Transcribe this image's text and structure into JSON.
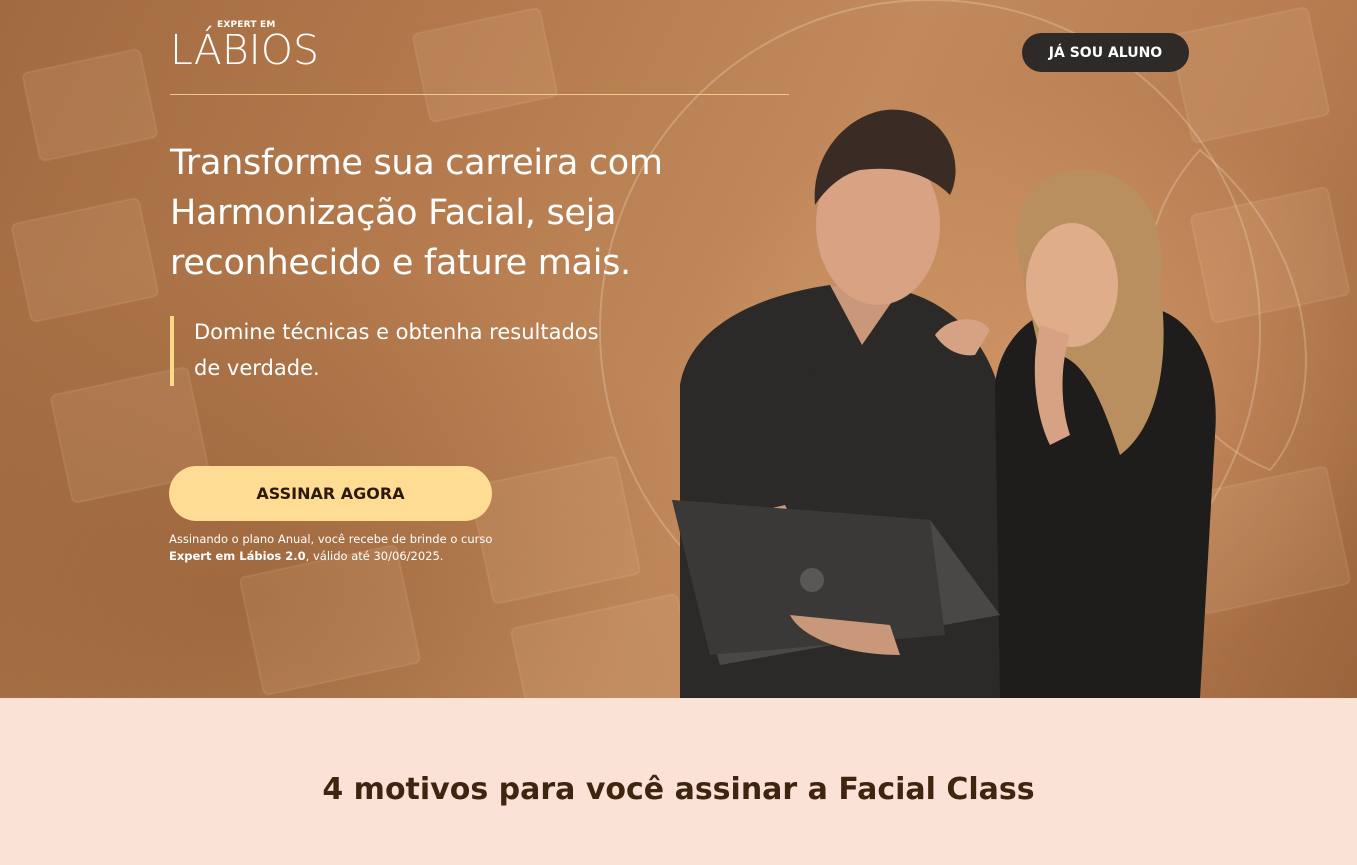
{
  "header": {
    "logo_small": "EXPERT EM",
    "logo_big": "LÁBIOS",
    "student_button": "JÁ SOU ALUNO"
  },
  "hero": {
    "headline": "Transforme sua carreira com Harmonização Facial, seja reconhecido e fature mais.",
    "subline": "Domine técnicas e obtenha resultados de verdade.",
    "cta_button": "ASSINAR AGORA",
    "bonus_prefix": "Assinando o plano Anual, você recebe de brinde o curso ",
    "bonus_bold": "Expert em Lábios 2.0",
    "bonus_suffix": ", válido até 30/06/2025.",
    "image_alt": "Photo of a man holding a laptop next to a smiling woman",
    "colors": {
      "accent": "#ffdc93",
      "bar": "#ffd98a",
      "dark_button": "#2e2a28"
    }
  },
  "section": {
    "title": "4 motivos para você assinar a Facial Class"
  }
}
